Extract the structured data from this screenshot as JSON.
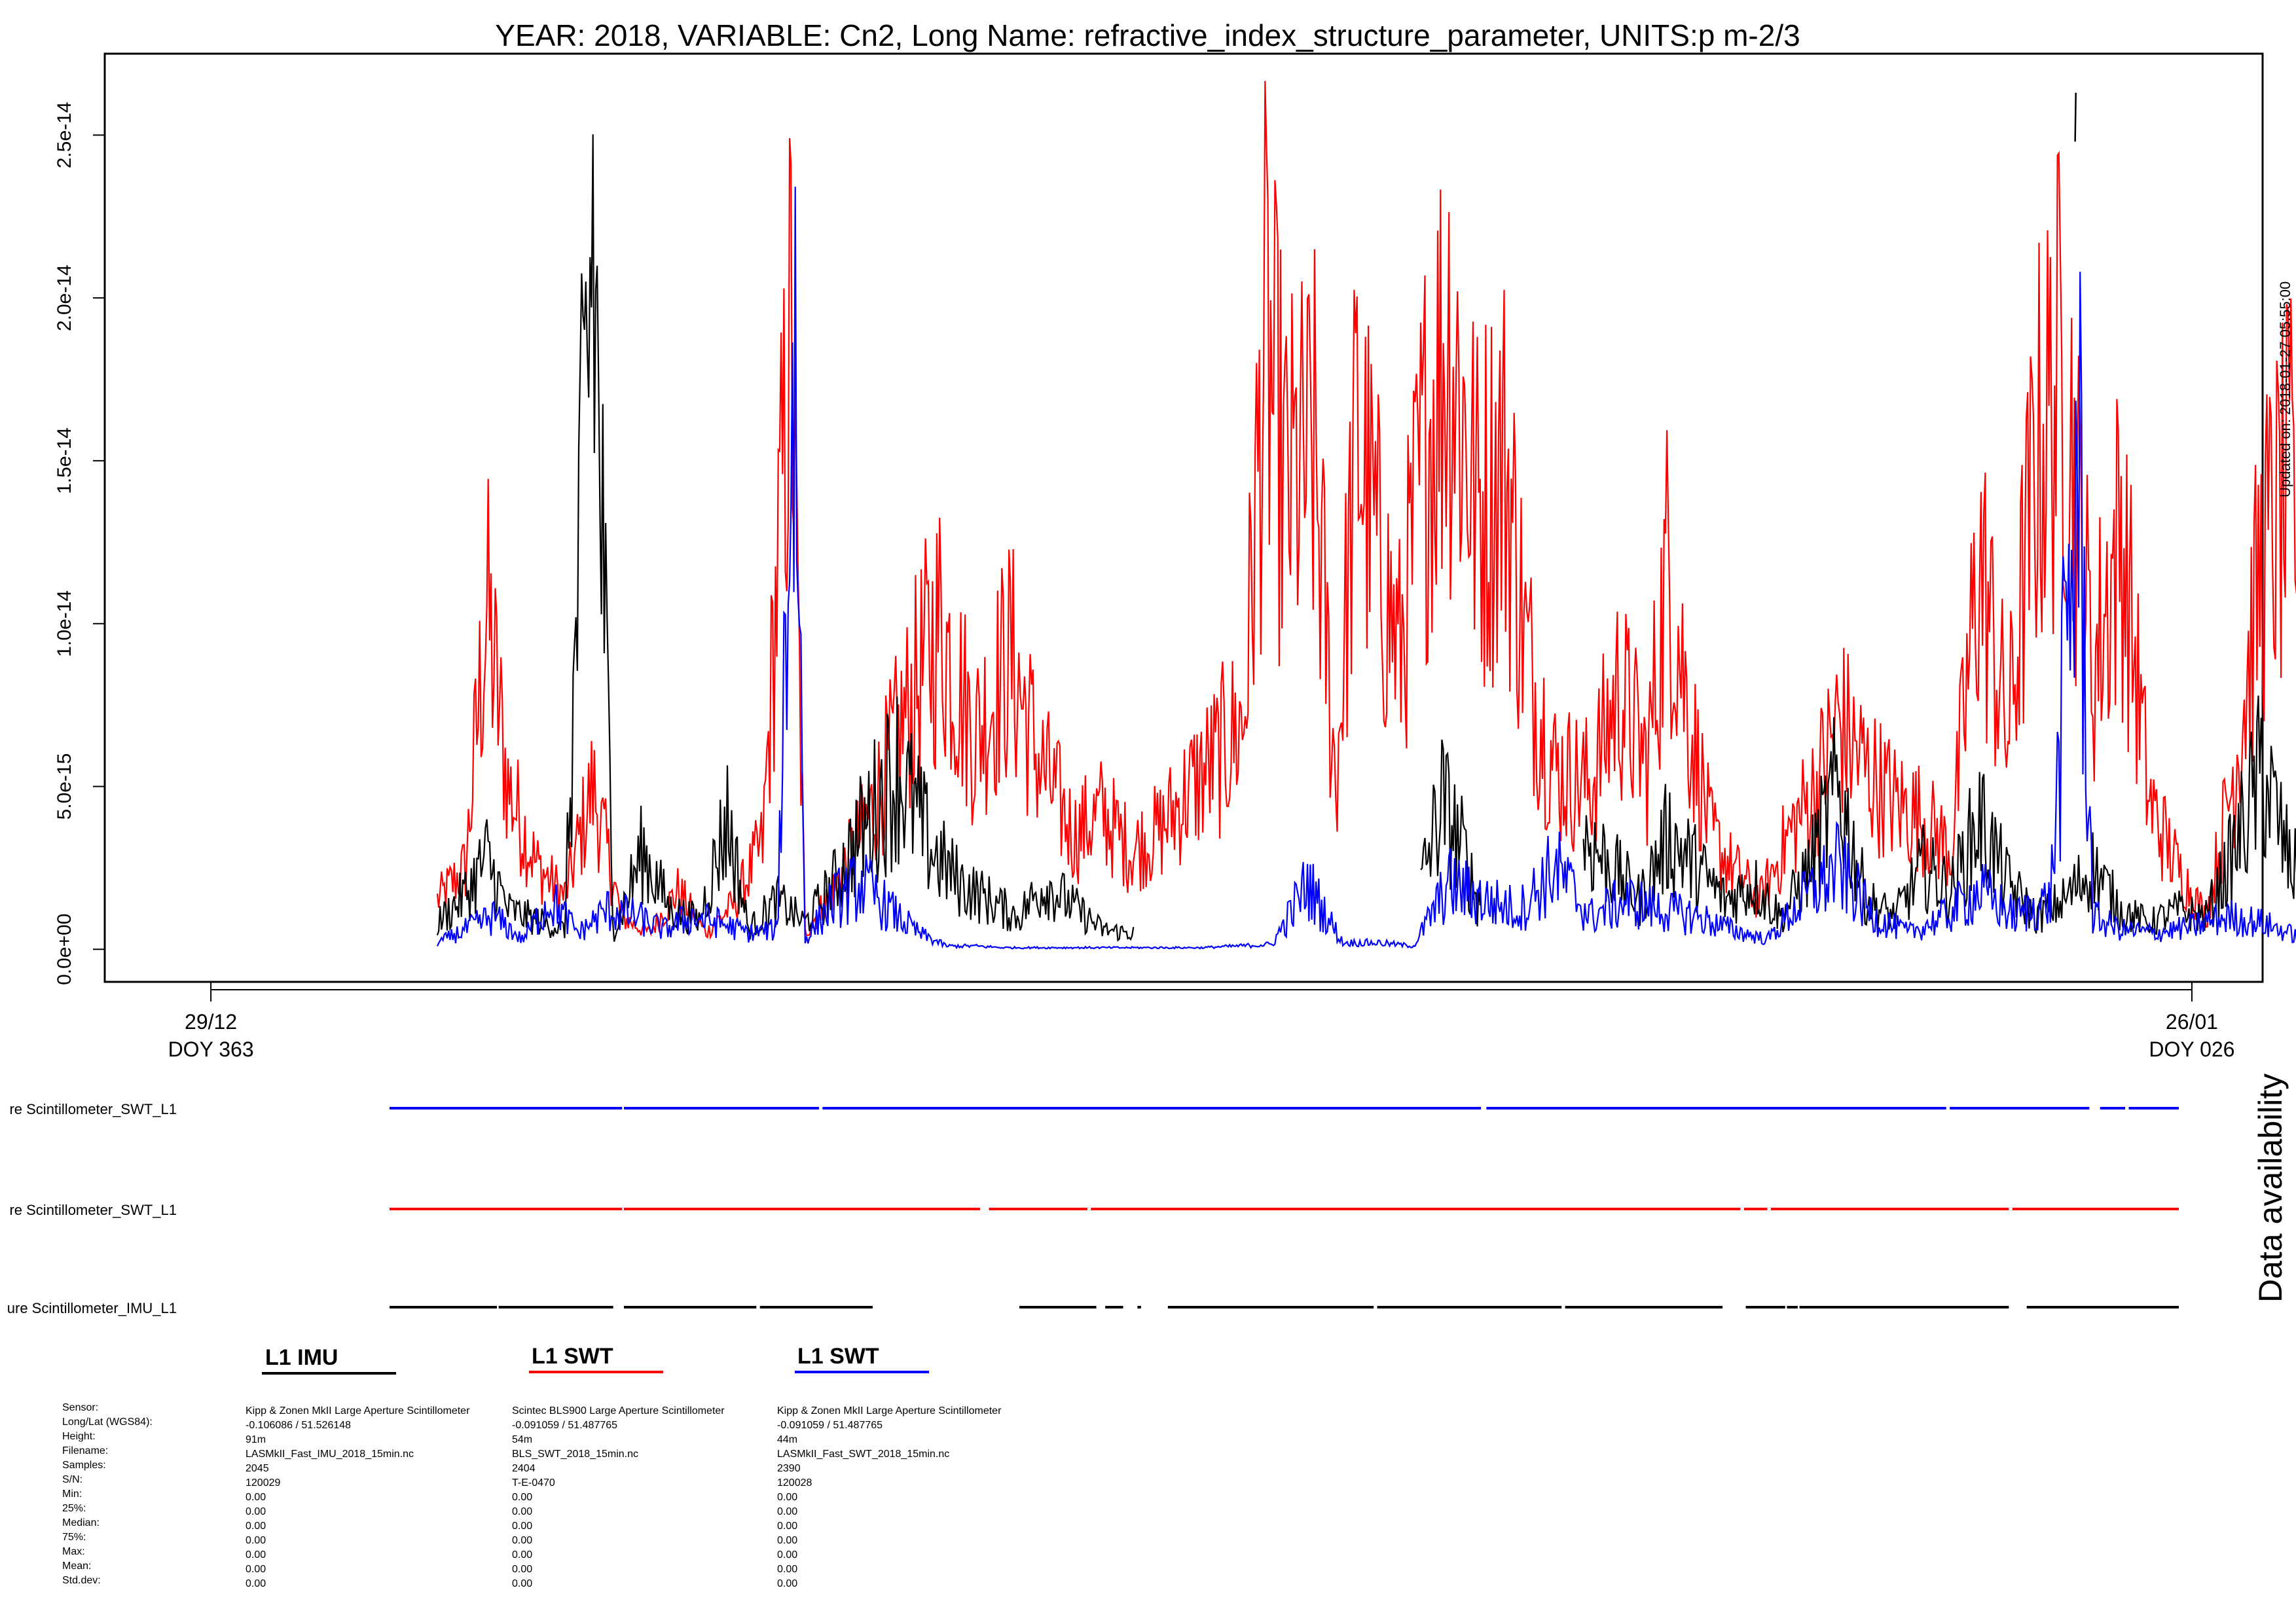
{
  "chart_data": {
    "type": "line",
    "title": "YEAR: 2018, VARIABLE: Cn2, Long Name: refractive_index_structure_parameter, UNITS:p m-2/3",
    "xlabel": "",
    "ylabel": "",
    "ylim": [
      -1e-15,
      2.75e-14
    ],
    "xlim": [
      362.0,
      27.0
    ],
    "y_ticks": [
      "0.0e+00",
      "5.0e-15",
      "1.0e-14",
      "1.5e-14",
      "2.0e-14",
      "2.5e-14"
    ],
    "y_tick_values": [
      0,
      5e-15,
      1e-14,
      1.5e-14,
      2e-14,
      2.5e-14
    ],
    "x_ticks": [
      {
        "date": "29/12",
        "doy": "DOY 363",
        "day_index": 0
      },
      {
        "date": "26/01",
        "doy": "DOY 026",
        "day_index": 28
      }
    ],
    "x_range_days": [
      -1.5,
      29.0
    ],
    "series": [
      {
        "name": "L1 SWT",
        "color": "#ff0000",
        "keyframes": [
          [
            3.2,
            1.5e-15
          ],
          [
            3.6,
            2.5e-15
          ],
          [
            3.9,
            1.05e-14
          ],
          [
            4.2,
            5e-15
          ],
          [
            4.6,
            2.6e-15
          ],
          [
            5.0,
            1.6e-15
          ],
          [
            5.4,
            5e-15
          ],
          [
            5.8,
            1e-15
          ],
          [
            6.2,
            5e-16
          ],
          [
            6.6,
            1.8e-15
          ],
          [
            7.0,
            5e-16
          ],
          [
            7.4,
            1.4e-15
          ],
          [
            7.8,
            3.2e-15
          ],
          [
            8.2,
            1.9e-14
          ],
          [
            8.4,
            5e-16
          ],
          [
            8.8,
            1.8e-15
          ],
          [
            9.3,
            4e-15
          ],
          [
            9.8,
            7e-15
          ],
          [
            10.3,
            1e-14
          ],
          [
            10.8,
            6.5e-15
          ],
          [
            11.3,
            9e-15
          ],
          [
            11.7,
            5.8e-15
          ],
          [
            12.2,
            3.5e-15
          ],
          [
            12.6,
            4.2e-15
          ],
          [
            13.0,
            3e-15
          ],
          [
            13.4,
            3.6e-15
          ],
          [
            13.8,
            4.8e-15
          ],
          [
            14.2,
            5.8e-15
          ],
          [
            14.6,
            7e-15
          ],
          [
            14.9,
            1.85e-14
          ],
          [
            15.2,
            1.4e-14
          ],
          [
            15.6,
            1.5e-14
          ],
          [
            15.9,
            5e-15
          ],
          [
            16.2,
            1.6e-14
          ],
          [
            16.5,
            1.2e-14
          ],
          [
            16.8,
            9e-15
          ],
          [
            17.2,
            1.6e-14
          ],
          [
            17.5,
            1.9e-14
          ],
          [
            17.9,
            1.35e-14
          ],
          [
            18.3,
            1.5e-14
          ],
          [
            18.6,
            9e-15
          ],
          [
            19.0,
            5.5e-15
          ],
          [
            19.5,
            5e-15
          ],
          [
            19.9,
            8e-15
          ],
          [
            20.3,
            5.6e-15
          ],
          [
            20.6,
            1.2e-14
          ],
          [
            20.9,
            7e-15
          ],
          [
            21.2,
            3.5e-15
          ],
          [
            21.5,
            2.5e-15
          ],
          [
            21.9,
            1.5e-15
          ],
          [
            22.3,
            3.5e-15
          ],
          [
            22.7,
            5e-15
          ],
          [
            23.0,
            7e-15
          ],
          [
            23.4,
            5.5e-15
          ],
          [
            23.8,
            4.5e-15
          ],
          [
            24.2,
            4e-15
          ],
          [
            24.6,
            3e-15
          ],
          [
            25.0,
            1.2e-14
          ],
          [
            25.4,
            6.5e-15
          ],
          [
            25.8,
            1.5e-14
          ],
          [
            26.2,
            1.8e-14
          ],
          [
            26.6,
            8.5e-15
          ],
          [
            27.0,
            1.3e-14
          ],
          [
            27.4,
            4.5e-15
          ],
          [
            27.8,
            2.5e-15
          ],
          [
            28.2,
            1e-15
          ],
          [
            28.6,
            5.5e-15
          ],
          [
            29.0,
            1.2e-14
          ],
          [
            29.4,
            1.4e-14
          ],
          [
            29.8,
            1e-14
          ],
          [
            30.1,
            8.5e-15
          ]
        ]
      },
      {
        "name": "L1 IMU",
        "color": "#000000",
        "keyframes": [
          [
            3.2,
            8e-16
          ],
          [
            3.6,
            1.7e-15
          ],
          [
            3.9,
            2.8e-15
          ],
          [
            4.2,
            1.2e-15
          ],
          [
            4.6,
            9e-16
          ],
          [
            5.0,
            6e-16
          ],
          [
            5.4,
            2.2e-14
          ],
          [
            5.7,
            5e-16
          ],
          [
            6.1,
            3e-15
          ],
          [
            6.5,
            1.2e-15
          ],
          [
            6.9,
            9e-16
          ],
          [
            7.3,
            4e-15
          ],
          [
            7.6,
            6e-16
          ],
          [
            8.0,
            1.5e-15
          ],
          [
            8.4,
            8e-16
          ],
          [
            8.8,
            2e-15
          ],
          [
            9.3,
            4e-15
          ],
          [
            9.7,
            5.5e-15
          ],
          [
            10.2,
            3e-15
          ],
          [
            10.6,
            2e-15
          ],
          [
            11.0,
            1.5e-15
          ],
          [
            11.4,
            1e-15
          ],
          [
            11.8,
            2e-15
          ],
          [
            12.2,
            1.3e-15
          ],
          [
            12.6,
            6e-16
          ],
          [
            13.0,
            5e-16
          ]
        ],
        "gaps": [
          [
            13.05,
            17.1
          ],
          [
            18.0,
            19.4
          ]
        ],
        "keyframes2": [
          [
            17.1,
            2e-15
          ],
          [
            17.4,
            4.5e-15
          ],
          [
            17.7,
            3e-15
          ],
          [
            17.9,
            1.5e-15
          ],
          [
            19.4,
            3.5e-15
          ],
          [
            19.8,
            2.5e-15
          ],
          [
            20.2,
            1.5e-15
          ],
          [
            20.6,
            3.5e-15
          ],
          [
            21.0,
            2.5e-15
          ],
          [
            21.4,
            1.5e-15
          ],
          [
            21.8,
            2e-15
          ],
          [
            22.2,
            1e-15
          ],
          [
            22.6,
            2.5e-15
          ],
          [
            23.0,
            5e-15
          ],
          [
            23.4,
            1.5e-15
          ],
          [
            23.8,
            1e-15
          ],
          [
            24.2,
            2.5e-15
          ],
          [
            24.6,
            1.8e-15
          ],
          [
            25.0,
            4e-15
          ],
          [
            25.4,
            2e-15
          ],
          [
            25.8,
            1e-15
          ],
          [
            26.2,
            1.5e-15
          ],
          [
            26.6,
            2.5e-15
          ],
          [
            27.0,
            1.2e-15
          ],
          [
            27.4,
            8e-16
          ],
          [
            27.8,
            1.2e-15
          ],
          [
            28.2,
            1e-15
          ],
          [
            28.6,
            3e-15
          ],
          [
            29.0,
            5.5e-15
          ],
          [
            29.4,
            2.5e-15
          ],
          [
            29.8,
            2e-15
          ],
          [
            30.1,
            2e-15
          ]
        ]
      },
      {
        "name": "L1 SWT",
        "color": "#0000ff",
        "keyframes": [
          [
            3.2,
            2e-16
          ],
          [
            3.6,
            6e-16
          ],
          [
            4.0,
            1e-15
          ],
          [
            4.4,
            3e-16
          ],
          [
            4.8,
            1.5e-15
          ],
          [
            5.2,
            5e-16
          ],
          [
            5.6,
            1.2e-15
          ],
          [
            6.0,
            1e-15
          ],
          [
            6.4,
            6e-16
          ],
          [
            6.8,
            1e-15
          ],
          [
            7.2,
            8e-16
          ],
          [
            7.6,
            5e-16
          ],
          [
            8.0,
            6e-16
          ],
          [
            8.25,
            1.9e-14
          ],
          [
            8.4,
            3e-16
          ],
          [
            8.8,
            1.5e-15
          ],
          [
            9.2,
            2e-15
          ],
          [
            9.6,
            1.2e-15
          ],
          [
            10.0,
            5e-16
          ],
          [
            10.4,
            1e-16
          ],
          [
            10.8,
            1e-16
          ],
          [
            11.2,
            5e-17
          ],
          [
            12.0,
            5e-17
          ],
          [
            13.0,
            5e-17
          ],
          [
            14.0,
            5e-17
          ],
          [
            15.0,
            1.5e-16
          ],
          [
            15.5,
            2e-15
          ],
          [
            16.0,
            2e-16
          ],
          [
            16.5,
            2e-16
          ],
          [
            17.0,
            1e-16
          ],
          [
            17.5,
            2e-15
          ],
          [
            18.0,
            1.5e-15
          ],
          [
            18.5,
            1.2e-15
          ],
          [
            19.0,
            2.5e-15
          ],
          [
            19.5,
            1e-15
          ],
          [
            20.0,
            1.5e-15
          ],
          [
            20.5,
            1.2e-15
          ],
          [
            21.0,
            1e-15
          ],
          [
            21.5,
            6e-16
          ],
          [
            22.0,
            3e-16
          ],
          [
            22.5,
            1.5e-15
          ],
          [
            23.0,
            2.5e-15
          ],
          [
            23.5,
            1e-15
          ],
          [
            24.0,
            5e-16
          ],
          [
            24.5,
            1e-15
          ],
          [
            25.0,
            1.8e-15
          ],
          [
            25.5,
            1e-15
          ],
          [
            26.0,
            1.5e-15
          ],
          [
            26.4,
            1.5e-14
          ],
          [
            26.6,
            1e-15
          ],
          [
            27.0,
            6e-16
          ],
          [
            27.5,
            5e-16
          ],
          [
            28.0,
            7e-16
          ],
          [
            28.5,
            1e-15
          ],
          [
            29.0,
            8e-16
          ],
          [
            29.5,
            4e-16
          ],
          [
            30.1,
            4e-16
          ]
        ]
      }
    ]
  },
  "updated_text": "Updated on: 2018-01-27 05:55:00",
  "availability": {
    "title": "Data availability",
    "rows": [
      {
        "label": "re Scintillometer_SWT_L1",
        "color": "#0000ff"
      },
      {
        "label": "re Scintillometer_SWT_L1",
        "color": "#ff0000"
      },
      {
        "label": "ure Scintillometer_IMU_L1",
        "color": "#000000"
      }
    ]
  },
  "legend": [
    {
      "title": "L1 IMU",
      "color": "#000000"
    },
    {
      "title": "L1 SWT",
      "color": "#ff0000"
    },
    {
      "title": "L1 SWT",
      "color": "#0000ff"
    }
  ],
  "stats": {
    "labels": [
      "Sensor:",
      "Long/Lat (WGS84):",
      "Height:",
      "Filename:",
      "Samples:",
      "S/N:",
      "Min:",
      "25%:",
      "Median:",
      "75%:",
      "Max:",
      "Mean:",
      "Std.dev:"
    ],
    "columns": [
      [
        "Kipp & Zonen MkII Large Aperture Scintillometer",
        "-0.106086 / 51.526148",
        "91m",
        "LASMkII_Fast_IMU_2018_15min.nc",
        "2045",
        "120029",
        "0.00",
        "0.00",
        "0.00",
        "0.00",
        "0.00",
        "0.00",
        "0.00"
      ],
      [
        "Scintec BLS900 Large Aperture Scintillometer",
        "-0.091059 / 51.487765",
        "54m",
        "BLS_SWT_2018_15min.nc",
        "2404",
        "T-E-0470",
        "0.00",
        "0.00",
        "0.00",
        "0.00",
        "0.00",
        "0.00",
        "0.00"
      ],
      [
        "Kipp & Zonen MkII Large Aperture Scintillometer",
        "-0.091059 / 51.487765",
        "44m",
        "LASMkII_Fast_SWT_2018_15min.nc",
        "2390",
        "120028",
        "0.00",
        "0.00",
        "0.00",
        "0.00",
        "0.00",
        "0.00",
        "0.00"
      ]
    ]
  }
}
